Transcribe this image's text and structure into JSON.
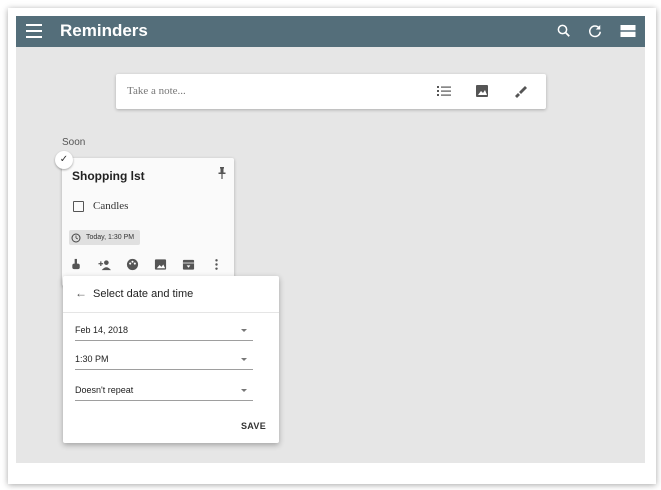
{
  "app": {
    "title": "Reminders"
  },
  "toolbar_icons": [
    "menu-icon",
    "search-icon",
    "refresh-icon",
    "list-view-icon"
  ],
  "take_note": {
    "placeholder": "Take a note...",
    "icons": [
      "checklist-icon",
      "image-icon",
      "brush-icon"
    ]
  },
  "section": {
    "label": "Soon"
  },
  "note": {
    "title": "Shopping lst",
    "checked_icon": "✓",
    "items": [
      {
        "text": "Candles",
        "checked": false
      }
    ],
    "reminder": {
      "text": "Today, 1:30 PM"
    },
    "toolbar_icons": [
      "reminder-icon",
      "collaborator-icon",
      "palette-icon",
      "image-icon",
      "archive-icon",
      "more-icon"
    ]
  },
  "popup": {
    "back_icon": "←",
    "title": "Select date and time",
    "date": "Feb 14, 2018",
    "time": "1:30 PM",
    "repeat": "Doesn't repeat",
    "save_label": "SAVE"
  },
  "colors": {
    "app_bar": "#546e7a",
    "content_bg": "#e6e6e6",
    "card_bg": "#fafafa"
  }
}
